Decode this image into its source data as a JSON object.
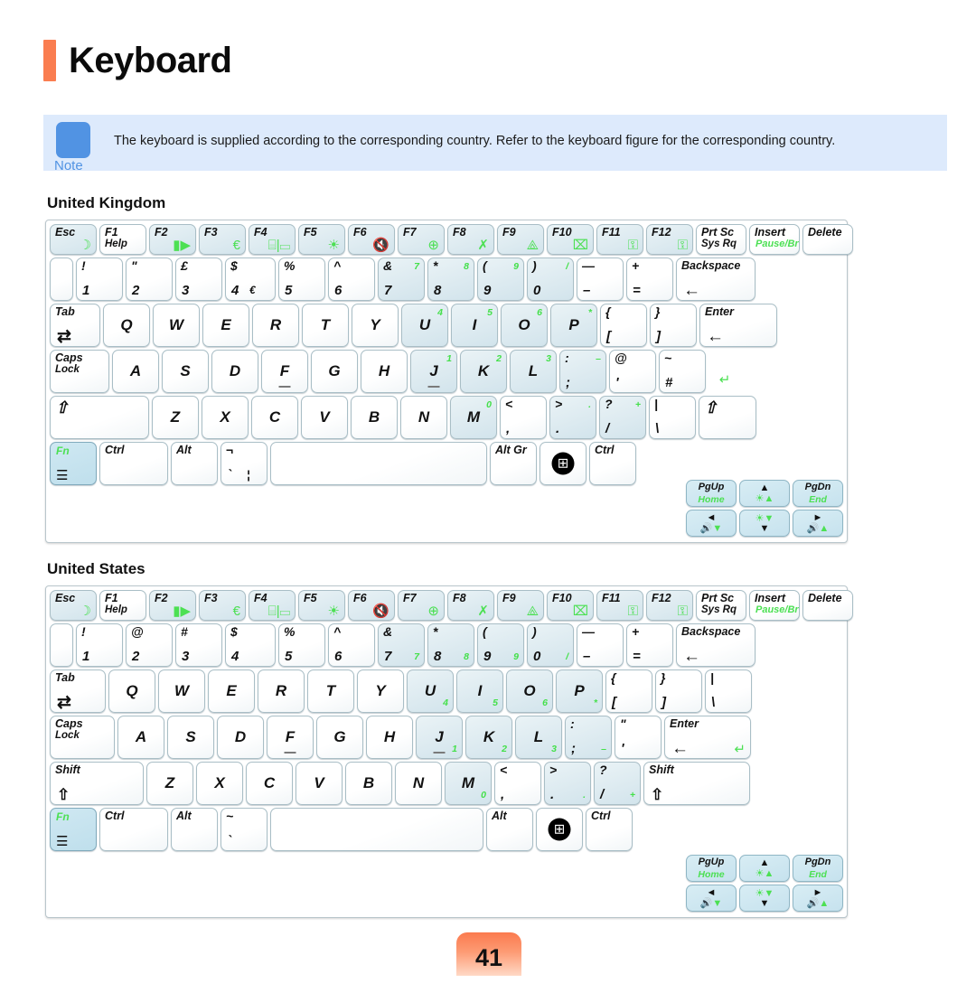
{
  "page": {
    "title": "Keyboard",
    "page_number": "41",
    "accent_color": "#fa7d50",
    "note_accent": "#5193e3",
    "green_legend_color": "#4ce053"
  },
  "note": {
    "label": "Note",
    "text": "The keyboard is supplied according to the corresponding country. Refer to the keyboard figure for the corresponding country."
  },
  "sections": {
    "uk_title": "United Kingdom",
    "us_title": "United States"
  },
  "uk_keyboard": {
    "function_row": [
      {
        "top": "Esc",
        "icon": "moon-icon",
        "glyph": "☽",
        "tint": true
      },
      {
        "top": "F1",
        "sub": "Help",
        "tint": false
      },
      {
        "top": "F2",
        "icon": "battery-icon",
        "glyph": "▮▶",
        "tint": true
      },
      {
        "top": "F3",
        "icon": "euro-icon",
        "glyph": "€",
        "tint": true
      },
      {
        "top": "F4",
        "icon": "display-switch-icon",
        "glyph": "⌸|▭",
        "tint": true
      },
      {
        "top": "F5",
        "icon": "brightness-icon",
        "glyph": "☀",
        "tint": true
      },
      {
        "top": "F6",
        "icon": "mute-icon",
        "glyph": "🔇",
        "tint": true
      },
      {
        "top": "F7",
        "icon": "network-icon",
        "glyph": "⊕",
        "tint": true
      },
      {
        "top": "F8",
        "icon": "performance-icon",
        "glyph": "✗",
        "tint": true
      },
      {
        "top": "F9",
        "icon": "wireless-icon",
        "glyph": "⟁",
        "tint": true
      },
      {
        "top": "F10",
        "icon": "touchpad-lock-icon",
        "glyph": "⌧",
        "tint": true
      },
      {
        "top": "F11",
        "icon": "num-lock-icon",
        "glyph": "⚿",
        "tint": true
      },
      {
        "top": "F12",
        "icon": "scroll-lock-icon",
        "glyph": "⚿",
        "tint": true
      },
      {
        "top": "Prt Sc",
        "sub": "Sys Rq",
        "tint": false
      },
      {
        "top": "Insert",
        "sub_green": "Pause/Brk",
        "tint": false
      },
      {
        "top": "Delete",
        "tint": false
      }
    ],
    "number_row": [
      {
        "top": "",
        "bot": "",
        "blank": true
      },
      {
        "top": "!",
        "bot": "1"
      },
      {
        "top": "\"",
        "bot": "2"
      },
      {
        "top": "£",
        "bot": "3"
      },
      {
        "top": "$",
        "bot": "4",
        "extra": "€"
      },
      {
        "top": "%",
        "bot": "5"
      },
      {
        "top": "^",
        "bot": "6"
      },
      {
        "top": "&",
        "bot": "7",
        "green_tr": "7",
        "tint": true
      },
      {
        "top": "*",
        "bot": "8",
        "green_tr": "8",
        "tint": true
      },
      {
        "top": "(",
        "bot": "9",
        "green_tr": "9",
        "tint": true
      },
      {
        "top": ")",
        "bot": "0",
        "green_tr": "/",
        "tint": true
      },
      {
        "top": "—",
        "bot": "–"
      },
      {
        "top": "+",
        "bot": "="
      },
      {
        "label": "Backspace",
        "arrow": "←",
        "wide": true
      }
    ],
    "qwerty_row": [
      {
        "label": "Tab",
        "arrow": "⇄"
      },
      {
        "ctr": "Q"
      },
      {
        "ctr": "W"
      },
      {
        "ctr": "E"
      },
      {
        "ctr": "R"
      },
      {
        "ctr": "T"
      },
      {
        "ctr": "Y"
      },
      {
        "ctr": "U",
        "green_tr": "4",
        "tint": true
      },
      {
        "ctr": "I",
        "green_tr": "5",
        "tint": true
      },
      {
        "ctr": "O",
        "green_tr": "6",
        "tint": true
      },
      {
        "ctr": "P",
        "green_tr": "*",
        "tint": true
      },
      {
        "top": "{",
        "bot": "["
      },
      {
        "top": "}",
        "bot": "]"
      },
      {
        "label": "Enter",
        "arrow": "←",
        "wide": true
      }
    ],
    "home_row": [
      {
        "label": "Caps",
        "sub": "Lock"
      },
      {
        "ctr": "A"
      },
      {
        "ctr": "S"
      },
      {
        "ctr": "D"
      },
      {
        "ctr": "F",
        "bump": true
      },
      {
        "ctr": "G"
      },
      {
        "ctr": "H"
      },
      {
        "ctr": "J",
        "green_tr": "1",
        "bump": true,
        "tint": true
      },
      {
        "ctr": "K",
        "green_tr": "2",
        "tint": true
      },
      {
        "ctr": "L",
        "green_tr": "3",
        "tint": true
      },
      {
        "top": ":",
        "bot": ";",
        "green_tr": "–",
        "tint": true
      },
      {
        "top": "@",
        "bot": "'"
      },
      {
        "top": "~",
        "bot": "#"
      },
      {
        "enter_green": "↵"
      }
    ],
    "shift_row": [
      {
        "shift": "⇧",
        "wide": true
      },
      {
        "ctr": "Z"
      },
      {
        "ctr": "X"
      },
      {
        "ctr": "C"
      },
      {
        "ctr": "V"
      },
      {
        "ctr": "B"
      },
      {
        "ctr": "N"
      },
      {
        "ctr": "M",
        "green_tr": "0",
        "tint": true
      },
      {
        "top": "<",
        "bot": ","
      },
      {
        "top": ">",
        "bot": ".",
        "green_tr": ".",
        "tint": true
      },
      {
        "top": "?",
        "bot": "/",
        "green_tr": "+",
        "tint": true
      },
      {
        "top": "|",
        "bot": "\\"
      },
      {
        "shift": "⇧"
      }
    ],
    "bottom_row": [
      {
        "fn": "Fn",
        "icon": "menu-icon"
      },
      {
        "label": "Ctrl"
      },
      {
        "label": "Alt"
      },
      {
        "top": "¬",
        "bot": "`",
        "extra2": "¦"
      },
      {
        "space": true
      },
      {
        "label": "Alt Gr"
      },
      {
        "win": true
      },
      {
        "label": "Ctrl"
      }
    ],
    "nav_cluster": [
      {
        "top": "PgUp",
        "bot_green": "Home"
      },
      {
        "arrow_top": "▲",
        "bot_mix": "☀▲"
      },
      {
        "top": "PgDn",
        "bot_green": "End"
      },
      {
        "arrow_top": "◄",
        "bot_mix": "🔊▼"
      },
      {
        "mix_top": "☀▼",
        "arrow_bot": "▼"
      },
      {
        "arrow_top": "►",
        "bot_mix": "🔊▲"
      }
    ]
  },
  "us_keyboard": {
    "function_row": [
      {
        "top": "Esc",
        "icon": "moon-icon",
        "glyph": "☽",
        "tint": true
      },
      {
        "top": "F1",
        "sub": "Help",
        "tint": false
      },
      {
        "top": "F2",
        "icon": "battery-icon",
        "glyph": "▮▶",
        "tint": true
      },
      {
        "top": "F3",
        "icon": "euro-icon",
        "glyph": "€",
        "tint": true
      },
      {
        "top": "F4",
        "icon": "display-switch-icon",
        "glyph": "⌸|▭",
        "tint": true
      },
      {
        "top": "F5",
        "icon": "brightness-icon",
        "glyph": "☀",
        "tint": true
      },
      {
        "top": "F6",
        "icon": "mute-icon",
        "glyph": "🔇",
        "tint": true
      },
      {
        "top": "F7",
        "icon": "network-icon",
        "glyph": "⊕",
        "tint": true
      },
      {
        "top": "F8",
        "icon": "performance-icon",
        "glyph": "✗",
        "tint": true
      },
      {
        "top": "F9",
        "icon": "wireless-icon",
        "glyph": "⟁",
        "tint": true
      },
      {
        "top": "F10",
        "icon": "touchpad-lock-icon",
        "glyph": "⌧",
        "tint": true
      },
      {
        "top": "F11",
        "icon": "num-lock-icon",
        "glyph": "⚿",
        "tint": true
      },
      {
        "top": "F12",
        "icon": "scroll-lock-icon",
        "glyph": "⚿",
        "tint": true
      },
      {
        "top": "Prt Sc",
        "sub": "Sys Rq",
        "tint": false
      },
      {
        "top": "Insert",
        "sub_green": "Pause/Brk",
        "tint": false
      },
      {
        "top": "Delete",
        "tint": false
      }
    ],
    "number_row": [
      {
        "blank": true
      },
      {
        "top": "!",
        "bot": "1"
      },
      {
        "top": "@",
        "bot": "2"
      },
      {
        "top": "#",
        "bot": "3"
      },
      {
        "top": "$",
        "bot": "4"
      },
      {
        "top": "%",
        "bot": "5"
      },
      {
        "top": "^",
        "bot": "6"
      },
      {
        "top": "&",
        "bot": "7",
        "green_br": "7",
        "tint": true
      },
      {
        "top": "*",
        "bot": "8",
        "green_br": "8",
        "tint": true
      },
      {
        "top": "(",
        "bot": "9",
        "green_br": "9",
        "tint": true
      },
      {
        "top": ")",
        "bot": "0",
        "green_br": "/",
        "tint": true
      },
      {
        "top": "—",
        "bot": "–"
      },
      {
        "top": "+",
        "bot": "="
      },
      {
        "label": "Backspace",
        "arrow": "←",
        "wide": true
      }
    ],
    "qwerty_row": [
      {
        "label": "Tab",
        "arrow": "⇄"
      },
      {
        "ctr": "Q"
      },
      {
        "ctr": "W"
      },
      {
        "ctr": "E"
      },
      {
        "ctr": "R"
      },
      {
        "ctr": "T"
      },
      {
        "ctr": "Y"
      },
      {
        "ctr": "U",
        "green_br": "4",
        "tint": true
      },
      {
        "ctr": "I",
        "green_br": "5",
        "tint": true
      },
      {
        "ctr": "O",
        "green_br": "6",
        "tint": true
      },
      {
        "ctr": "P",
        "green_br": "*",
        "tint": true
      },
      {
        "top": "{",
        "bot": "["
      },
      {
        "top": "}",
        "bot": "]"
      },
      {
        "top": "|",
        "bot": "\\"
      }
    ],
    "home_row": [
      {
        "label": "Caps",
        "sub": "Lock"
      },
      {
        "ctr": "A"
      },
      {
        "ctr": "S"
      },
      {
        "ctr": "D"
      },
      {
        "ctr": "F",
        "bump": true
      },
      {
        "ctr": "G"
      },
      {
        "ctr": "H"
      },
      {
        "ctr": "J",
        "green_br": "1",
        "bump": true,
        "tint": true
      },
      {
        "ctr": "K",
        "green_br": "2",
        "tint": true
      },
      {
        "ctr": "L",
        "green_br": "3",
        "tint": true
      },
      {
        "top": ":",
        "bot": ";",
        "green_br": "–",
        "tint": true
      },
      {
        "top": "\"",
        "bot": "'"
      },
      {
        "label": "Enter",
        "arrow": "←",
        "enter_green": "↵",
        "wide": true
      }
    ],
    "shift_row": [
      {
        "label": "Shift",
        "shift_arrow": "⇧",
        "wide": true
      },
      {
        "ctr": "Z"
      },
      {
        "ctr": "X"
      },
      {
        "ctr": "C"
      },
      {
        "ctr": "V"
      },
      {
        "ctr": "B"
      },
      {
        "ctr": "N"
      },
      {
        "ctr": "M",
        "green_br": "0",
        "tint": true
      },
      {
        "top": "<",
        "bot": ","
      },
      {
        "top": ">",
        "bot": ".",
        "green_br": ".",
        "tint": true
      },
      {
        "top": "?",
        "bot": "/",
        "green_br": "+",
        "tint": true
      },
      {
        "label": "Shift",
        "shift_arrow": "⇧",
        "wide": true
      }
    ],
    "bottom_row": [
      {
        "fn": "Fn",
        "icon": "menu-icon"
      },
      {
        "label": "Ctrl"
      },
      {
        "label": "Alt"
      },
      {
        "top": "~",
        "bot": "`"
      },
      {
        "space": true
      },
      {
        "label": "Alt"
      },
      {
        "win": true
      },
      {
        "label": "Ctrl"
      }
    ],
    "nav_cluster": [
      {
        "top": "PgUp",
        "bot_green": "Home"
      },
      {
        "arrow_top": "▲",
        "bot_mix": "☀▲"
      },
      {
        "top": "PgDn",
        "bot_green": "End"
      },
      {
        "arrow_top": "◄",
        "bot_mix": "🔊▼"
      },
      {
        "mix_top": "☀▼",
        "arrow_bot": "▼"
      },
      {
        "arrow_top": "►",
        "bot_mix": "🔊▲"
      }
    ]
  }
}
